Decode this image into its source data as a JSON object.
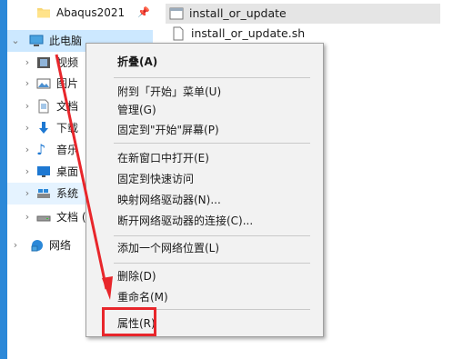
{
  "nav": {
    "quick_access_item": "Abaqus2021",
    "this_pc": "此电脑",
    "videos": "视频",
    "pictures": "图片",
    "documents": "文档",
    "downloads": "下载",
    "music": "音乐",
    "desktop": "桌面",
    "system_drive": "系统",
    "docs_drive": "文档 (",
    "network": "网络"
  },
  "files": [
    "install_or_update",
    "install_or_update.sh"
  ],
  "menu": {
    "collapse": "折叠(A)",
    "pin_start": "附到「开始」菜单(U)",
    "manage": "管理(G)",
    "pin_start_screen": "固定到\"开始\"屏幕(P)",
    "open_new_window": "在新窗口中打开(E)",
    "pin_quick": "固定到快速访问",
    "map_drive": "映射网络驱动器(N)...",
    "disconnect_drive": "断开网络驱动器的连接(C)...",
    "add_network_location": "添加一个网络位置(L)",
    "delete": "删除(D)",
    "rename": "重命名(M)",
    "properties": "属性(R)"
  },
  "colors": {
    "accent": "#2b88d8",
    "selection": "#cce8ff",
    "annotation_red": "#e8262b"
  }
}
